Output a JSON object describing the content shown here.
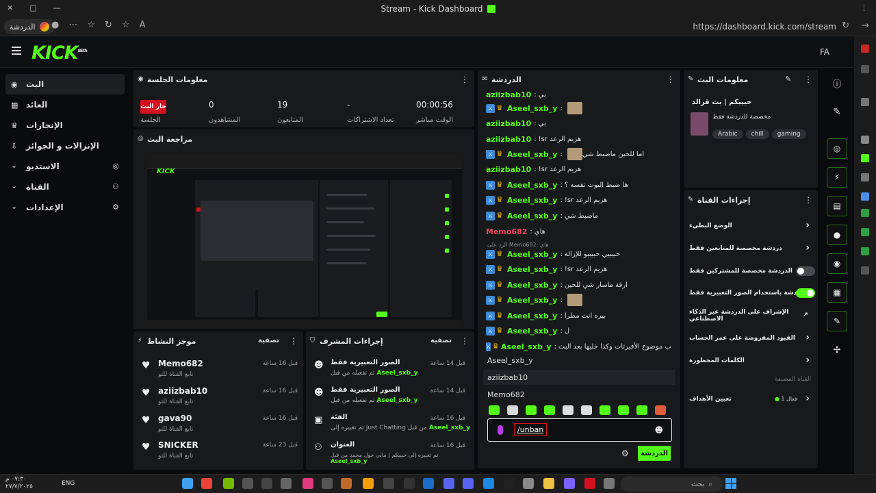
{
  "titlebar": {
    "title": "Stream - Kick Dashboard"
  },
  "browser": {
    "profile_label": "الدردشة",
    "url": "https://dashboard.kick.com/stream"
  },
  "header": {
    "logo": "KICK",
    "logo_beta": "BETA",
    "user_initials": "FA"
  },
  "sidebar": {
    "items": [
      {
        "label": "البث",
        "icon": "broadcast-icon"
      },
      {
        "label": "العائد",
        "icon": "revenue-icon"
      },
      {
        "label": "الإنجازات",
        "icon": "trophy-icon"
      },
      {
        "label": "الإنزالات و الجوائز",
        "icon": "drops-icon"
      },
      {
        "label": "الاستديو",
        "icon": "studio-icon"
      },
      {
        "label": "القناة",
        "icon": "channel-icon"
      },
      {
        "label": "الإعدادات",
        "icon": "gear-icon"
      }
    ]
  },
  "session": {
    "title": "معلومات الجلسة",
    "live_badge": "جار البث",
    "session_label": "الجلسة",
    "viewers_value": "0",
    "viewers_label": "المشاهدون",
    "followers_value": "19",
    "followers_label": "المتابعون",
    "subs_value": "-",
    "subs_label": "تعداد الاشتراكات",
    "time_value": "00:00:56",
    "time_label": "الوقت مباشر"
  },
  "preview": {
    "title": "مراجعة البث"
  },
  "activity": {
    "title": "موجز النشاط",
    "filter": "تصفية",
    "items": [
      {
        "name": "Memo682",
        "sub": "تابع القناة للتو",
        "time": "قبل 16 ساعة"
      },
      {
        "name": "aziizbab10",
        "sub": "تابع القناة للتو",
        "time": "قبل 16 ساعة"
      },
      {
        "name": "gava90",
        "sub": "تابع القناة للتو",
        "time": "قبل 16 ساعة"
      },
      {
        "name": "SNICKER",
        "sub": "تابع القناة للتو",
        "time": "قبل 23 ساعة"
      }
    ]
  },
  "modactions": {
    "title": "إجراءات المشرف",
    "filter": "تصفية",
    "items": [
      {
        "title": "الصور التعبيرية فقط",
        "sub": "تم تفعيله من قبل",
        "user": "Aseel_sxb_y",
        "time": "قبل 14 ساعة"
      },
      {
        "title": "الصور التعبيرية فقط",
        "sub": "تم تفعيله من قبل",
        "user": "Aseel_sxb_y",
        "time": "قبل 14 ساعة"
      },
      {
        "title": "الفئة",
        "sub": "تم تغييره إلى Just Chatting من قبل",
        "user": "Aseel_sxb_y",
        "time": "قبل 16 ساعة"
      },
      {
        "title": "العنوان",
        "sub": "تم تغييره إلى حبيبكم | ماني جول محمد من قبل",
        "user": "Aseel_sxb_y",
        "time": "قبل 16 ساعة"
      }
    ]
  },
  "chat": {
    "title": "الدردشة",
    "messages": [
      {
        "user": "aziizbab10",
        "color": "#53fc18",
        "text": "بي",
        "badges": false,
        "emote": false
      },
      {
        "user": "Aseel_sxb_y",
        "color": "#53fc18",
        "text": "",
        "badges": true,
        "emote": true
      },
      {
        "user": "aziizbab10",
        "color": "#53fc18",
        "text": "بي",
        "badges": false,
        "emote": false
      },
      {
        "user": "aziizbab10",
        "color": "#53fc18",
        "text": "!sr هزيم الرعد",
        "badges": false,
        "emote": false
      },
      {
        "user": "Aseel_sxb_y",
        "color": "#53fc18",
        "text": "اما للحين ماضبط شي",
        "badges": true,
        "emote": true
      },
      {
        "user": "aziizbab10",
        "color": "#53fc18",
        "text": "!sr هزيم الرعد",
        "badges": false,
        "emote": false
      },
      {
        "user": "Aseel_sxb_y",
        "color": "#53fc18",
        "text": "ها ضبط البوت نفسه ؟",
        "badges": true,
        "emote": false
      },
      {
        "user": "Aseel_sxb_y",
        "color": "#53fc18",
        "text": "!sr هزيم الرعد",
        "badges": true,
        "emote": false
      },
      {
        "user": "Aseel_sxb_y",
        "color": "#53fc18",
        "text": "ماضبط شي",
        "badges": true,
        "emote": false
      },
      {
        "user": "Memo682",
        "color": "#e8465c",
        "text": "هاي",
        "badges": false,
        "emote": false
      },
      {
        "user": "Aseel_sxb_y",
        "color": "#53fc18",
        "text": "حبيبيي حبيبيو للإزالة",
        "badges": true,
        "emote": false
      },
      {
        "user": "Aseel_sxb_y",
        "color": "#53fc18",
        "text": "!sr هزيم الرعد",
        "badges": true,
        "emote": false
      },
      {
        "user": "Aseel_sxb_y",
        "color": "#53fc18",
        "text": "ارفة ماسار شي للحين",
        "badges": true,
        "emote": false
      },
      {
        "user": "Aseel_sxb_y",
        "color": "#53fc18",
        "text": "",
        "badges": true,
        "emote": true
      },
      {
        "user": "Aseel_sxb_y",
        "color": "#53fc18",
        "text": "بيره انت مطرا",
        "badges": true,
        "emote": false
      },
      {
        "user": "Aseel_sxb_y",
        "color": "#53fc18",
        "text": "ل",
        "badges": true,
        "emote": false
      },
      {
        "user": "Aseel_sxb_y",
        "color": "#53fc18",
        "text": "طيب موضوع الأفيرتات وكذا خليها بعد البث",
        "badges": true,
        "emote": false
      }
    ],
    "reply_hint": "الرد على Memo682: هاي",
    "suggestions": [
      "Aseel_sxb_y",
      "aziizbab10",
      "Memo682"
    ],
    "input_command": "/unban",
    "send_label": "الدردشة"
  },
  "streaminfo": {
    "title": "معلومات البث",
    "stream_title": "حبيبكم | بث قرالد",
    "category": "مخصصة للدردشة فقط",
    "tags": [
      "Arabic",
      "chill",
      "gaming"
    ]
  },
  "channelactions": {
    "title": "إجراءات القناة",
    "rows": [
      {
        "label": "الوضع البطيء",
        "type": "chevron"
      },
      {
        "label": "دردشة مخصصة للمتابعين فقط",
        "type": "chevron"
      },
      {
        "label": "الدردشة مخصصة للمشتركين فقط",
        "type": "toggle",
        "on": false
      },
      {
        "label": "الدردشة باستخدام الصور التعبيرية فقط",
        "type": "toggle",
        "on": true
      },
      {
        "label": "الإشراف على الدردشة عبر الذكاء الاصطناعي",
        "type": "link"
      },
      {
        "label": "القيود المفروضة على عمر الحساب",
        "type": "chevron"
      },
      {
        "label": "الكلمات المحظورة",
        "type": "chevron"
      }
    ],
    "section_label": "القناة المضيفة",
    "goals_label": "تعيين الأهداف",
    "goals_status": "فعال 1"
  },
  "taskbar": {
    "lang": "ENG",
    "search": "بحث",
    "clock_time": "٠٧:٣٠ م",
    "clock_date": "٢٧/٧/٢٠٢٥"
  },
  "colors": {
    "accent": "#53fc18",
    "live": "#d4111f",
    "panel": "#18191b",
    "bg": "#0a0b0c"
  }
}
